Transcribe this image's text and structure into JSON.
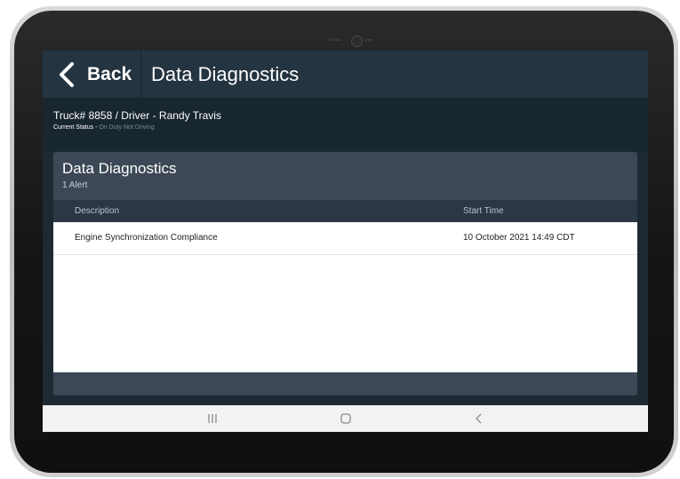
{
  "header": {
    "back_label": "Back",
    "title": "Data Diagnostics"
  },
  "truck": {
    "line": "Truck# 8858 / Driver - Randy Travis",
    "status_label": "Current Status -",
    "status_value": "On Duty Not Driving"
  },
  "panel": {
    "title": "Data Diagnostics",
    "subtitle": "1 Alert",
    "columns": [
      "Description",
      "Start Time"
    ],
    "rows": [
      {
        "description": "Engine Synchronization Compliance",
        "start_time": "10 October 2021 14:49 CDT"
      }
    ]
  },
  "device": {
    "camera_left_label": "MS955",
    "camera_right_label": "8mm"
  },
  "navbar": {
    "icons": [
      "recent-apps-icon",
      "home-icon",
      "back-nav-icon"
    ]
  },
  "colors": {
    "header_bg": "#243441",
    "screen_bg": "#1d2a33",
    "panel_bg": "#3c4856",
    "table_head_bg": "#2b3744",
    "status_muted": "#7a8b96"
  }
}
